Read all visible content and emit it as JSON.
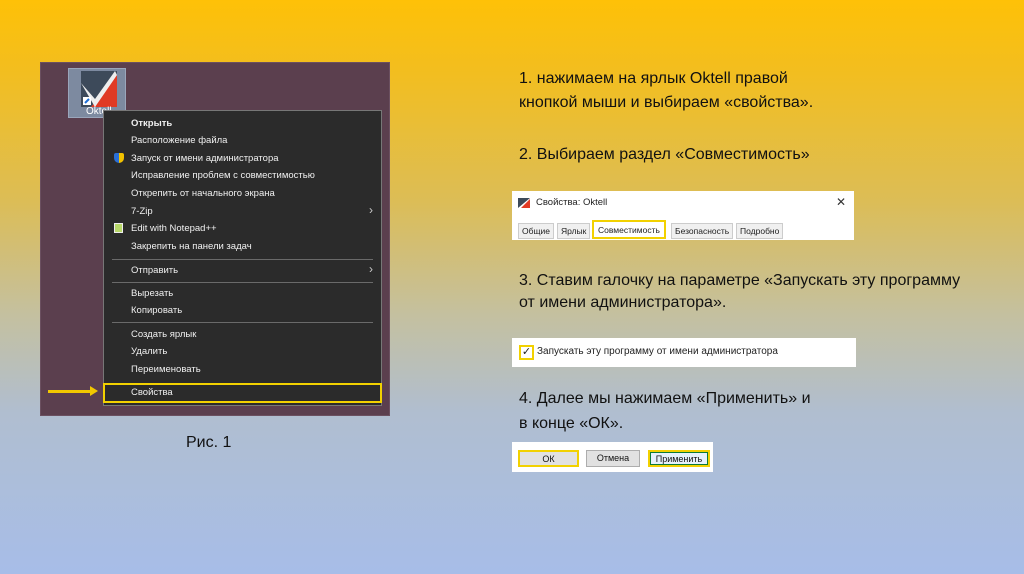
{
  "screenshot1": {
    "icon_label": "Oktell",
    "menu_items": [
      {
        "label": "Открыть",
        "bold": true
      },
      {
        "label": "Расположение файла"
      },
      {
        "label": "Запуск от имени администратора",
        "icon": "uac-shield-icon"
      },
      {
        "label": "Исправление проблем с совместимостью"
      },
      {
        "label": "Открепить от начального экрана"
      },
      {
        "label": "7-Zip",
        "submenu": true
      },
      {
        "label": "Edit with Notepad++",
        "icon": "notepad-icon"
      },
      {
        "label": "Закрепить на панели задач"
      },
      {
        "label": "Отправить",
        "submenu": true
      },
      {
        "label": "Вырезать"
      },
      {
        "label": "Копировать"
      },
      {
        "label": "Создать ярлык"
      },
      {
        "label": "Удалить"
      },
      {
        "label": "Переименовать"
      },
      {
        "label": "Свойства",
        "highlighted": true
      }
    ],
    "caption": "Рис. 1"
  },
  "steps": {
    "s1_line1": "1. нажимаем на ярлык Oktell правой",
    "s1_line2": "кнопкой мыши и выбираем «свойства».",
    "s2": "2. Выбираем раздел «Совместимость»",
    "s3_line1": "3. Ставим галочку на параметре «Запускать эту программу",
    "s3_line2": "от имени администратора».",
    "s4_line1": "4. Далее мы нажимаем «Применить» и",
    "s4_line2": "в конце «ОК»."
  },
  "dialog": {
    "title": "Свойства: Oktell",
    "close": "✕",
    "tabs": [
      "Общие",
      "Ярлык",
      "Совместимость",
      "Безопасность",
      "Подробно"
    ],
    "active_tab": "Совместимость"
  },
  "checkbox": {
    "label": "Запускать эту программу от имени администратора",
    "checked": true
  },
  "buttons": {
    "ok": "ОК",
    "cancel": "Отмена",
    "apply": "Применить"
  },
  "colors": {
    "highlight": "#f2d100",
    "menu_bg": "#2b2b2b"
  }
}
